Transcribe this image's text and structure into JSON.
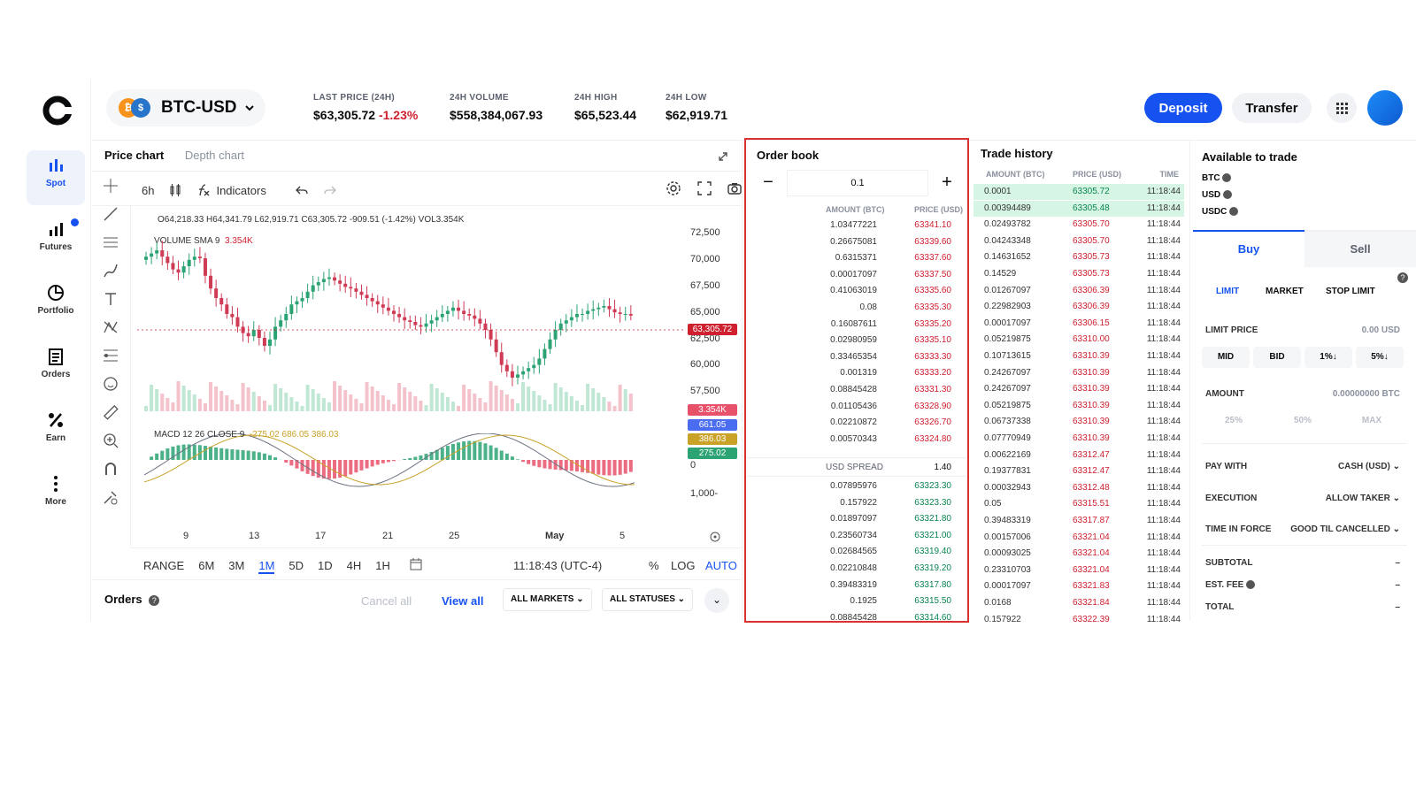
{
  "nav": [
    {
      "label": "Spot",
      "icon": "spot-chart-icon",
      "active": true
    },
    {
      "label": "Futures",
      "icon": "futures-bars-icon",
      "active": false
    },
    {
      "label": "Portfolio",
      "icon": "portfolio-pie-icon",
      "active": false
    },
    {
      "label": "Orders",
      "icon": "orders-doc-icon",
      "active": false
    },
    {
      "label": "Earn",
      "icon": "percent-icon",
      "active": false
    },
    {
      "label": "More",
      "icon": "more-dots-icon",
      "active": false
    }
  ],
  "header": {
    "pair": "BTC-USD",
    "stats": [
      {
        "label": "LAST PRICE (24H)",
        "value": "$63,305.72",
        "change": "-1.23%"
      },
      {
        "label": "24H VOLUME",
        "value": "$558,384,067.93"
      },
      {
        "label": "24H HIGH",
        "value": "$65,523.44"
      },
      {
        "label": "24H LOW",
        "value": "$62,919.71"
      }
    ],
    "deposit_label": "Deposit",
    "transfer_label": "Transfer"
  },
  "chart_panel": {
    "tabs": [
      "Price chart",
      "Depth chart"
    ],
    "interval": "6h",
    "indicators_label": "Indicators",
    "ohlc_text": "O64,218.33 H64,341.79 L62,919.71 C63,305.72 -909.51 (-1.42%) VOL3.354K",
    "volume_label": "VOLUME SMA 9",
    "volume_value": "3.354K",
    "macd_label": "MACD 12 26 CLOSE 9",
    "macd_values": "-275.02  686.05  386.03",
    "price_tag": "63,305.72",
    "tags": [
      "3.354K",
      "661.05",
      "386.03",
      "275.02"
    ],
    "y_ticks": [
      "72,500",
      "70,000",
      "67,500",
      "65,000",
      "62,500",
      "60,000",
      "57,500"
    ],
    "macd_ticks": [
      "0",
      "1,000-"
    ],
    "x_ticks": [
      "9",
      "13",
      "17",
      "21",
      "25",
      "May",
      "5"
    ],
    "ranges": [
      "RANGE",
      "6M",
      "3M",
      "1M",
      "5D",
      "1D",
      "4H",
      "1H"
    ],
    "active_range": "1M",
    "clock": "11:18:43 (UTC-4)",
    "pct_label": "%",
    "log_label": "LOG",
    "auto_label": "AUTO"
  },
  "orders_bar": {
    "title": "Orders",
    "cancel_all": "Cancel all",
    "view_all": "View all",
    "markets": "ALL MARKETS",
    "statuses": "ALL STATUSES"
  },
  "order_book": {
    "title": "Order book",
    "step": "0.1",
    "col_amount": "AMOUNT (BTC)",
    "col_price": "PRICE (USD)",
    "asks": [
      {
        "amount": "1.03477221",
        "price": "63341.10"
      },
      {
        "amount": "0.26675081",
        "price": "63339.60"
      },
      {
        "amount": "0.6315371",
        "price": "63337.60"
      },
      {
        "amount": "0.00017097",
        "price": "63337.50"
      },
      {
        "amount": "0.41063019",
        "price": "63335.60"
      },
      {
        "amount": "0.08",
        "price": "63335.30"
      },
      {
        "amount": "0.16087611",
        "price": "63335.20"
      },
      {
        "amount": "0.02980959",
        "price": "63335.10"
      },
      {
        "amount": "0.33465354",
        "price": "63333.30"
      },
      {
        "amount": "0.001319",
        "price": "63333.20"
      },
      {
        "amount": "0.08845428",
        "price": "63331.30"
      },
      {
        "amount": "0.01105436",
        "price": "63328.90"
      },
      {
        "amount": "0.02210872",
        "price": "63326.70"
      },
      {
        "amount": "0.00570343",
        "price": "63324.80"
      }
    ],
    "spread_label": "USD SPREAD",
    "spread_value": "1.40",
    "bids": [
      {
        "amount": "0.07895976",
        "price": "63323.30"
      },
      {
        "amount": "0.157922",
        "price": "63323.30"
      },
      {
        "amount": "0.01897097",
        "price": "63321.80"
      },
      {
        "amount": "0.23560734",
        "price": "63321.00"
      },
      {
        "amount": "0.02684565",
        "price": "63319.40"
      },
      {
        "amount": "0.02210848",
        "price": "63319.20"
      },
      {
        "amount": "0.39483319",
        "price": "63317.80"
      },
      {
        "amount": "0.1925",
        "price": "63315.50"
      },
      {
        "amount": "0.08845428",
        "price": "63314.60"
      }
    ]
  },
  "trade_history": {
    "title": "Trade history",
    "cols": [
      "AMOUNT (BTC)",
      "PRICE (USD)",
      "TIME"
    ],
    "rows": [
      {
        "amount": "0.0001",
        "price": "63305.72",
        "time": "11:18:44",
        "side": "buy"
      },
      {
        "amount": "0.00394489",
        "price": "63305.48",
        "time": "11:18:44",
        "side": "buy"
      },
      {
        "amount": "0.02493782",
        "price": "63305.70",
        "time": "11:18:44",
        "side": "sell"
      },
      {
        "amount": "0.04243348",
        "price": "63305.70",
        "time": "11:18:44",
        "side": "sell"
      },
      {
        "amount": "0.14631652",
        "price": "63305.73",
        "time": "11:18:44",
        "side": "sell"
      },
      {
        "amount": "0.14529",
        "price": "63305.73",
        "time": "11:18:44",
        "side": "sell"
      },
      {
        "amount": "0.01267097",
        "price": "63306.39",
        "time": "11:18:44",
        "side": "sell"
      },
      {
        "amount": "0.22982903",
        "price": "63306.39",
        "time": "11:18:44",
        "side": "sell"
      },
      {
        "amount": "0.00017097",
        "price": "63306.15",
        "time": "11:18:44",
        "side": "sell"
      },
      {
        "amount": "0.05219875",
        "price": "63310.00",
        "time": "11:18:44",
        "side": "sell"
      },
      {
        "amount": "0.10713615",
        "price": "63310.39",
        "time": "11:18:44",
        "side": "sell"
      },
      {
        "amount": "0.24267097",
        "price": "63310.39",
        "time": "11:18:44",
        "side": "sell"
      },
      {
        "amount": "0.24267097",
        "price": "63310.39",
        "time": "11:18:44",
        "side": "sell"
      },
      {
        "amount": "0.05219875",
        "price": "63310.39",
        "time": "11:18:44",
        "side": "sell"
      },
      {
        "amount": "0.06737338",
        "price": "63310.39",
        "time": "11:18:44",
        "side": "sell"
      },
      {
        "amount": "0.07770949",
        "price": "63310.39",
        "time": "11:18:44",
        "side": "sell"
      },
      {
        "amount": "0.00622169",
        "price": "63312.47",
        "time": "11:18:44",
        "side": "sell"
      },
      {
        "amount": "0.19377831",
        "price": "63312.47",
        "time": "11:18:44",
        "side": "sell"
      },
      {
        "amount": "0.00032943",
        "price": "63312.48",
        "time": "11:18:44",
        "side": "sell"
      },
      {
        "amount": "0.05",
        "price": "63315.51",
        "time": "11:18:44",
        "side": "sell"
      },
      {
        "amount": "0.39483319",
        "price": "63317.87",
        "time": "11:18:44",
        "side": "sell"
      },
      {
        "amount": "0.00157006",
        "price": "63321.04",
        "time": "11:18:44",
        "side": "sell"
      },
      {
        "amount": "0.00093025",
        "price": "63321.04",
        "time": "11:18:44",
        "side": "sell"
      },
      {
        "amount": "0.23310703",
        "price": "63321.04",
        "time": "11:18:44",
        "side": "sell"
      },
      {
        "amount": "0.00017097",
        "price": "63321.83",
        "time": "11:18:44",
        "side": "sell"
      },
      {
        "amount": "0.0168",
        "price": "63321.84",
        "time": "11:18:44",
        "side": "sell"
      },
      {
        "amount": "0.157922",
        "price": "63322.39",
        "time": "11:18:44",
        "side": "sell"
      }
    ]
  },
  "trade_form": {
    "title": "Available to trade",
    "balances": [
      "BTC",
      "USD",
      "USDC"
    ],
    "buy_label": "Buy",
    "sell_label": "Sell",
    "order_types": [
      "LIMIT",
      "MARKET",
      "STOP LIMIT"
    ],
    "limit_price_label": "LIMIT PRICE",
    "limit_price_value": "0.00",
    "limit_price_unit": "USD",
    "quick_prices": [
      "MID",
      "BID",
      "1%↓",
      "5%↓"
    ],
    "amount_label": "AMOUNT",
    "amount_value": "0.00000000",
    "amount_unit": "BTC",
    "pct_buttons": [
      "25%",
      "50%",
      "MAX"
    ],
    "pay_with_label": "PAY WITH",
    "pay_with_value": "CASH (USD)",
    "execution_label": "EXECUTION",
    "execution_value": "ALLOW TAKER",
    "tif_label": "TIME IN FORCE",
    "tif_value": "GOOD TIL CANCELLED",
    "subtotal_label": "SUBTOTAL",
    "fee_label": "EST. FEE",
    "total_label": "TOTAL",
    "dash": "–"
  }
}
